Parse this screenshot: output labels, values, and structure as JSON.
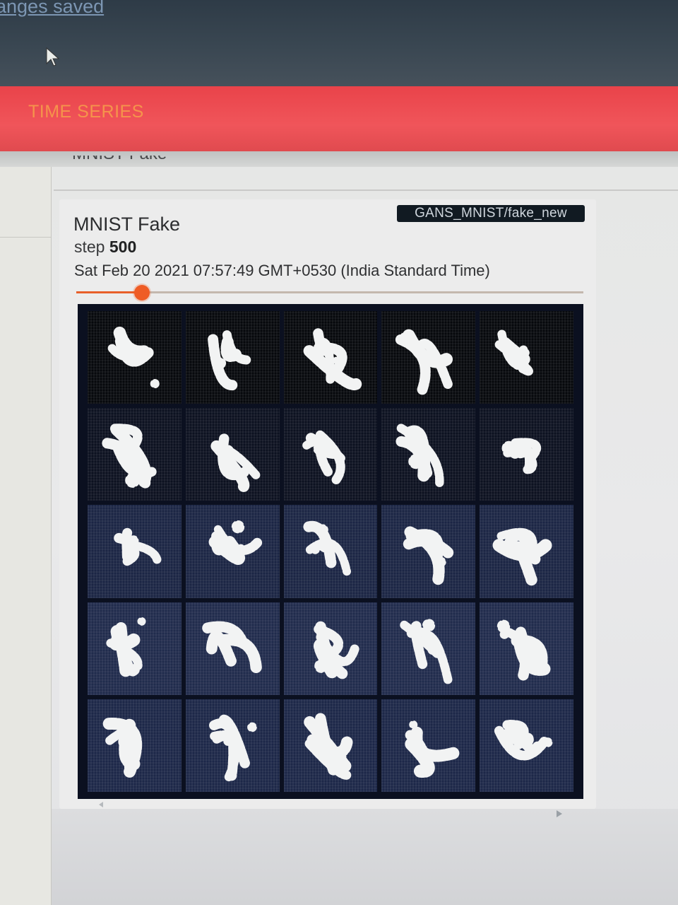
{
  "top_bar": {
    "status_text": "anges saved"
  },
  "header": {
    "tab_label": "TIME SERIES",
    "background_color": "#ee4d52",
    "label_color": "#f7a04a"
  },
  "previous_card": {
    "title_fragment": "MNIST Fake"
  },
  "image_card": {
    "tag": "GANS_MNIST/fake_new",
    "title": "MNIST Fake",
    "step_label": "step",
    "step_value": "500",
    "timestamp": "Sat Feb 20 2021 07:57:49 GMT+0530 (India Standard Time)",
    "slider": {
      "position_fraction": 0.13,
      "accent_color": "#ef5c25"
    },
    "sample_grid": {
      "rows": 5,
      "columns": 5,
      "description_icon": "generated-digit-samples"
    }
  }
}
